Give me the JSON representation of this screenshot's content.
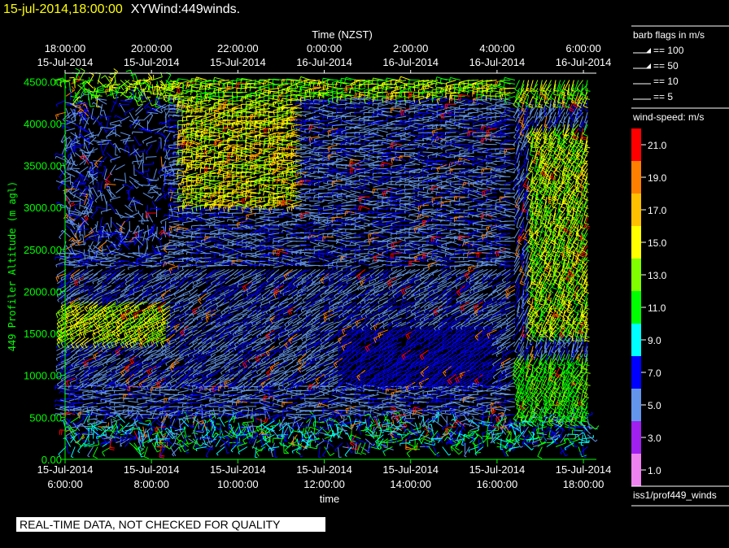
{
  "header": {
    "datetime": "15-jul-2014,18:00:00",
    "plot_name": "XYWind:449winds."
  },
  "qc_banner": "REAL-TIME DATA, NOT CHECKED FOR QUALITY",
  "barb_legend": {
    "title": "barb flags in m/s",
    "items": [
      "== 100",
      "== 50",
      "== 10",
      "== 5"
    ]
  },
  "speed_legend": {
    "title": "wind-speed: m/s",
    "levels": [
      {
        "label": "21.0",
        "color": "#ff0000"
      },
      {
        "label": "19.0",
        "color": "#ff8000"
      },
      {
        "label": "17.0",
        "color": "#ffc000"
      },
      {
        "label": "15.0",
        "color": "#ffff00"
      },
      {
        "label": "13.0",
        "color": "#80ff00"
      },
      {
        "label": "11.0",
        "color": "#00ff00"
      },
      {
        "label": "9.0",
        "color": "#00ffff"
      },
      {
        "label": "7.0",
        "color": "#0000ff"
      },
      {
        "label": "5.0",
        "color": "#6495ed"
      },
      {
        "label": "3.0",
        "color": "#a020f0"
      },
      {
        "label": "1.0",
        "color": "#ee82ee"
      }
    ]
  },
  "dataset_label": "iss1/prof449_winds",
  "chart_data": {
    "type": "scatter",
    "subtype": "wind-barb",
    "top_axis_title": "Time (NZST)",
    "top_ticks": [
      [
        "18:00:00",
        "15-Jul-2014"
      ],
      [
        "20:00:00",
        "15-Jul-2014"
      ],
      [
        "22:00:00",
        "15-Jul-2014"
      ],
      [
        "0:00:00",
        "16-Jul-2014"
      ],
      [
        "2:00:00",
        "16-Jul-2014"
      ],
      [
        "4:00:00",
        "16-Jul-2014"
      ],
      [
        "6:00:00",
        "16-Jul-2014"
      ]
    ],
    "bottom_ticks": [
      [
        "15-Jul-2014",
        "6:00:00"
      ],
      [
        "15-Jul-2014",
        "8:00:00"
      ],
      [
        "15-Jul-2014",
        "10:00:00"
      ],
      [
        "15-Jul-2014",
        "12:00:00"
      ],
      [
        "15-Jul-2014",
        "14:00:00"
      ],
      [
        "15-Jul-2014",
        "16:00:00"
      ],
      [
        "15-Jul-2014",
        "18:00:00"
      ]
    ],
    "xlabel": "time",
    "ylabel": "449 Profiler Altitude (m agl)",
    "x_hours": [
      6,
      8,
      10,
      12,
      14,
      16,
      18
    ],
    "xlim": [
      6,
      18.3
    ],
    "ylim": [
      0,
      4600
    ],
    "yticks": [
      0,
      500,
      1000,
      1500,
      2000,
      2500,
      3000,
      3500,
      4000,
      4500
    ],
    "ytick_labels": [
      "0.00",
      "500.00",
      "1000.00",
      "1500.00",
      "2000.00",
      "2500.00",
      "3000.00",
      "3500.00",
      "4000.00",
      "4500.00"
    ],
    "axis_color": "#00ff00",
    "grid": false,
    "speed_range": [
      1,
      21
    ]
  }
}
